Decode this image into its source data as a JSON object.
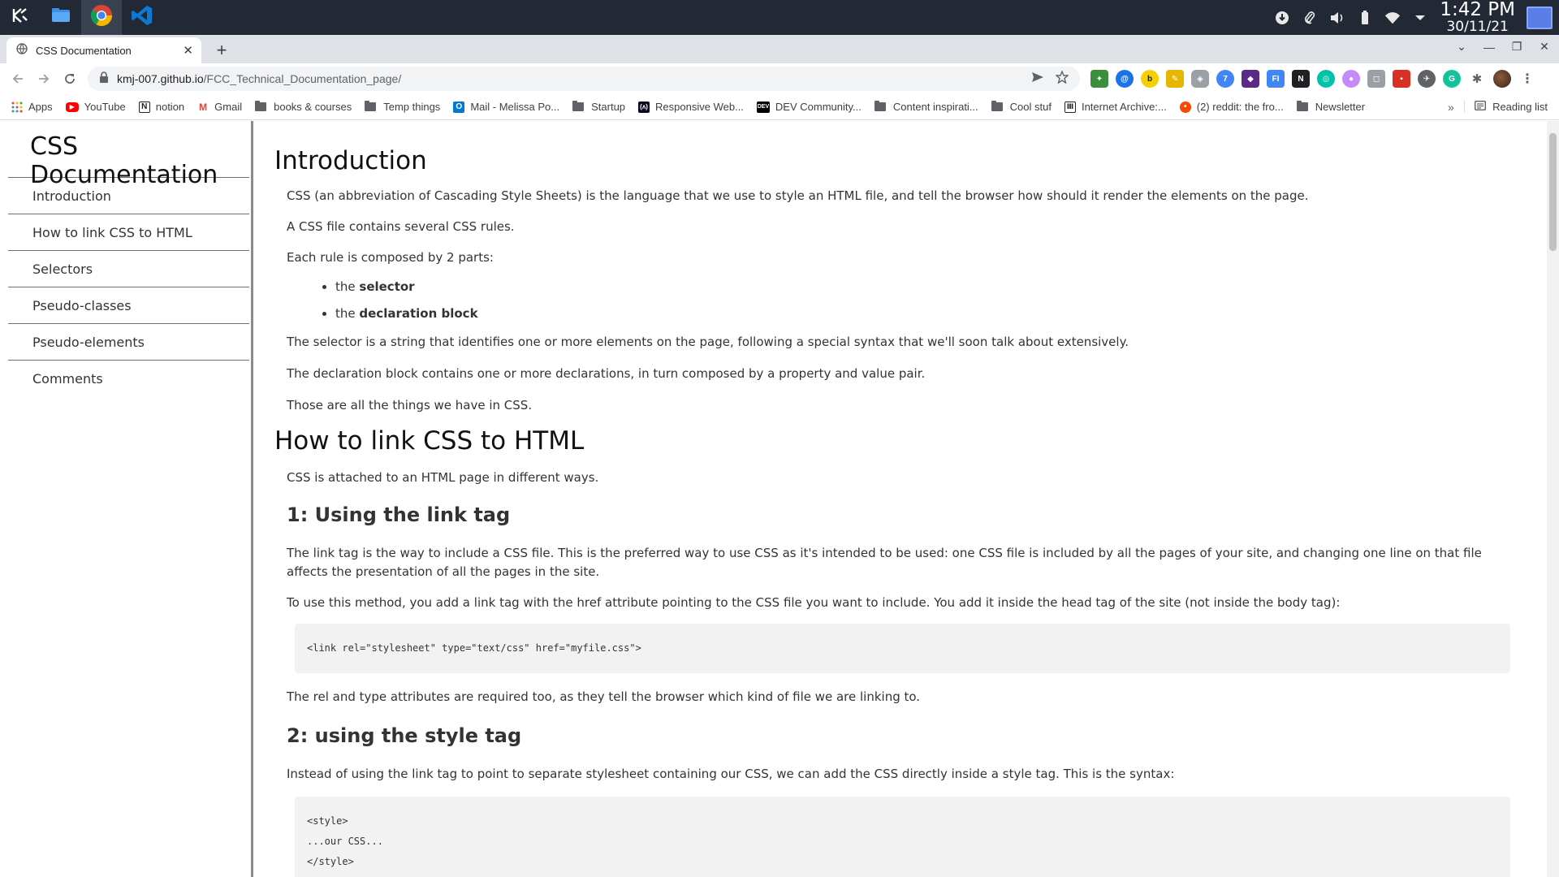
{
  "taskbar": {
    "apps": [
      {
        "icon": "kde-icon"
      },
      {
        "icon": "file-manager-icon"
      },
      {
        "icon": "chrome-icon"
      },
      {
        "icon": "vscode-icon"
      }
    ],
    "clock": {
      "time": "1:42 PM",
      "date": "30/11/21"
    }
  },
  "browser": {
    "tab": {
      "title": "CSS Documentation",
      "close": "✕"
    },
    "new_tab": "+",
    "window_controls": [
      "⌄",
      "—",
      "❐",
      "✕"
    ],
    "url_host": "kmj-007.github.io",
    "url_path": "/FCC_Technical_Documentation_page/",
    "bookmarks": [
      {
        "label": "Apps",
        "icon": "apps-grid-icon"
      },
      {
        "label": "YouTube",
        "icon": "youtube-icon"
      },
      {
        "label": "notion",
        "icon": "notion-icon"
      },
      {
        "label": "Gmail",
        "icon": "gmail-icon"
      },
      {
        "label": "books & courses",
        "icon": "folder-icon"
      },
      {
        "label": "Temp things",
        "icon": "folder-icon"
      },
      {
        "label": "Mail - Melissa Po...",
        "icon": "outlook-icon"
      },
      {
        "label": "Startup",
        "icon": "folder-icon"
      },
      {
        "label": "Responsive Web...",
        "icon": "fcc-icon"
      },
      {
        "label": "DEV Community...",
        "icon": "dev-icon"
      },
      {
        "label": "Content inspirati...",
        "icon": "folder-icon"
      },
      {
        "label": "Cool stuf",
        "icon": "folder-icon"
      },
      {
        "label": "Internet Archive:...",
        "icon": "archive-icon"
      },
      {
        "label": "(2) reddit: the fro...",
        "icon": "reddit-icon"
      },
      {
        "label": "Newsletter",
        "icon": "folder-icon"
      }
    ],
    "bookmarks_more": "»",
    "reading_list": "Reading list"
  },
  "page": {
    "nav_title": "CSS Documentation",
    "nav_links": [
      "Introduction",
      "How to link CSS to HTML",
      "Selectors",
      "Pseudo-classes",
      "Pseudo-elements",
      "Comments"
    ],
    "intro": {
      "heading": "Introduction",
      "p1": "CSS (an abbreviation of Cascading Style Sheets) is the language that we use to style an HTML file, and tell the browser how should it render the elements on the page.",
      "p2": "A CSS file contains several CSS rules.",
      "p3": "Each rule is composed by 2 parts:",
      "li1_pre": "the ",
      "li1_bold": "selector",
      "li2_pre": "the ",
      "li2_bold": "declaration block",
      "p4": "The selector is a string that identifies one or more elements on the page, following a special syntax that we'll soon talk about extensively.",
      "p5": "The declaration block contains one or more declarations, in turn composed by a property and value pair.",
      "p6": "Those are all the things we have in CSS."
    },
    "link": {
      "heading": "How to link CSS to HTML",
      "p1": "CSS is attached to an HTML page in different ways.",
      "sub1": "1: Using the link tag",
      "p2": "The link tag is the way to include a CSS file. This is the preferred way to use CSS as it's intended to be used: one CSS file is included by all the pages of your site, and changing one line on that file affects the presentation of all the pages in the site.",
      "p3": "To use this method, you add a link tag with the href attribute pointing to the CSS file you want to include. You add it inside the head tag of the site (not inside the body tag):",
      "code1": "<link rel=\"stylesheet\" type=\"text/css\" href=\"myfile.css\">",
      "p4": "The rel and type attributes are required too, as they tell the browser which kind of file we are linking to.",
      "sub2": "2: using the style tag",
      "p5": "Instead of using the link tag to point to separate stylesheet containing our CSS, we can add the CSS directly inside a style tag. This is the syntax:",
      "code2_l1": "<style>",
      "code2_l2": "...our CSS...",
      "code2_l3": "</style>"
    }
  }
}
